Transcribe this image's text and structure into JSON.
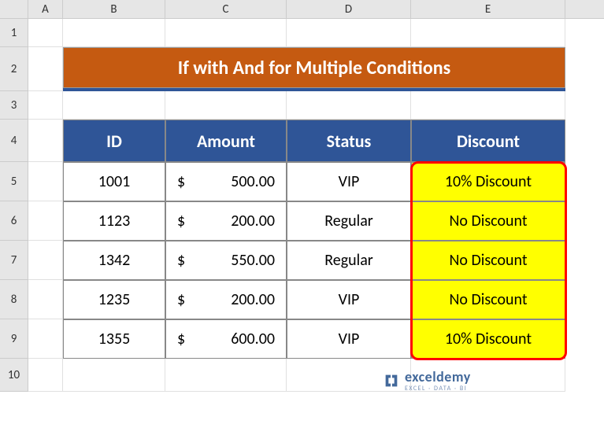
{
  "columns": [
    "A",
    "B",
    "C",
    "D",
    "E"
  ],
  "rows": [
    "1",
    "2",
    "3",
    "4",
    "5",
    "6",
    "7",
    "8",
    "9",
    "10"
  ],
  "title": "If with And for Multiple Conditions",
  "headers": {
    "id": "ID",
    "amount": "Amount",
    "status": "Status",
    "discount": "Discount"
  },
  "data": [
    {
      "id": "1001",
      "amount": "500.00",
      "status": "VIP",
      "discount": "10% Discount"
    },
    {
      "id": "1123",
      "amount": "200.00",
      "status": "Regular",
      "discount": "No Discount"
    },
    {
      "id": "1342",
      "amount": "550.00",
      "status": "Regular",
      "discount": "No Discount"
    },
    {
      "id": "1235",
      "amount": "200.00",
      "status": "VIP",
      "discount": "No Discount"
    },
    {
      "id": "1355",
      "amount": "600.00",
      "status": "VIP",
      "discount": "10% Discount"
    }
  ],
  "currency": "$",
  "brand": {
    "name": "exceldemy",
    "sub": "EXCEL · DATA · BI"
  },
  "colWidths": {
    "A": 44,
    "B": 130,
    "C": 154,
    "D": 158,
    "E": 196
  },
  "rowHeights": {
    "1": 36,
    "2": 56,
    "3": 36,
    "4": 54,
    "5": 50,
    "6": 50,
    "7": 50,
    "8": 50,
    "9": 50,
    "10": 42
  }
}
